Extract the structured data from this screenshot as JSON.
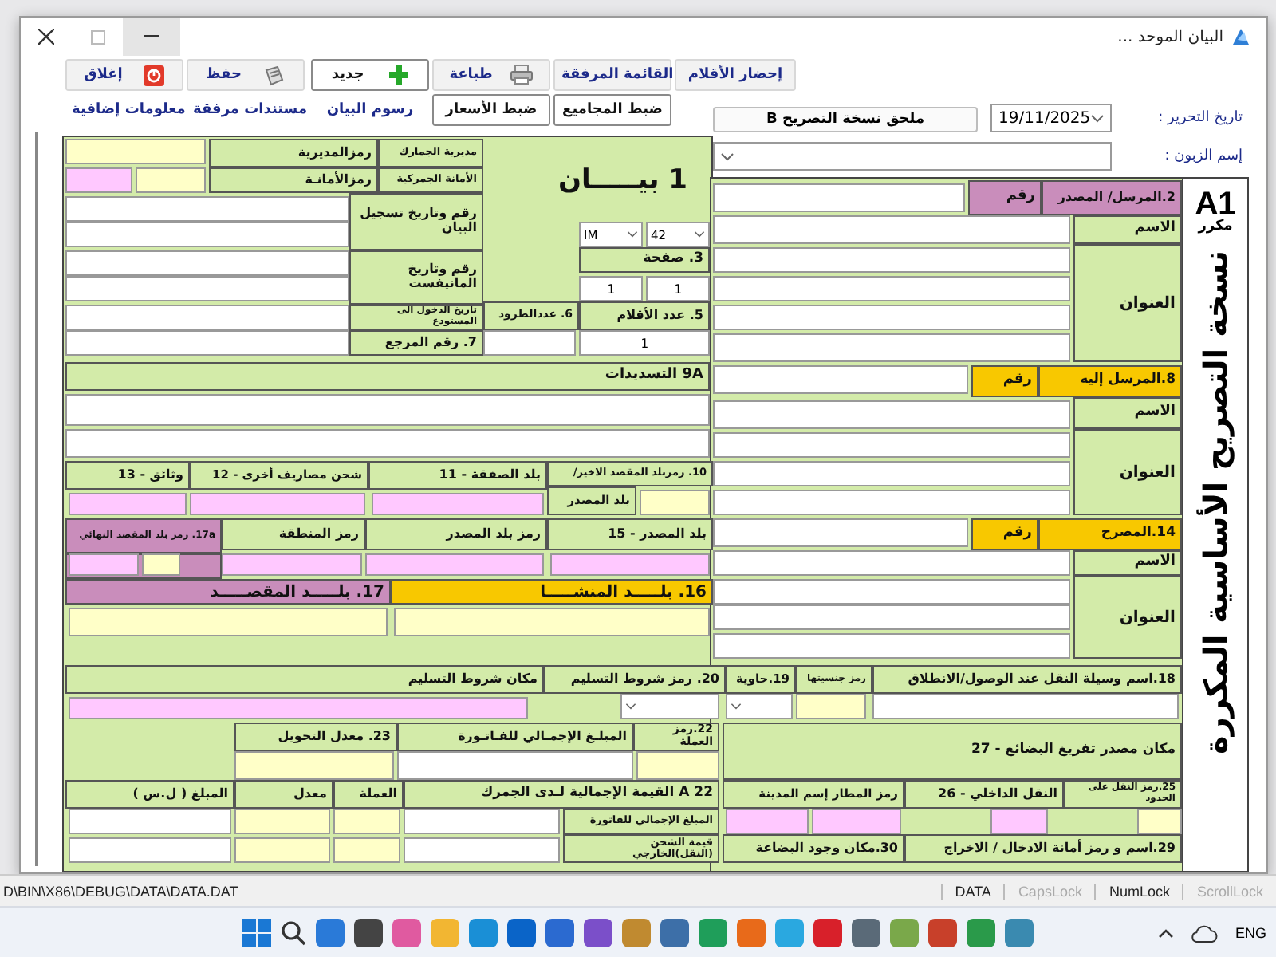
{
  "window": {
    "title": "البيان الموحد ..."
  },
  "toolbar": [
    {
      "label": "إحضار الأقلام",
      "kind": "raised"
    },
    {
      "label": "القائمة المرفقة",
      "kind": "raised"
    },
    {
      "label": "طباعة",
      "kind": "raised"
    },
    {
      "label": "جديد",
      "kind": "default"
    },
    {
      "label": "حفظ",
      "kind": "raised"
    },
    {
      "label": "إغلاق",
      "kind": "raised"
    },
    {
      "label": "ضبط المجاميع",
      "kind": "default"
    },
    {
      "label": "ضبط الأسعار",
      "kind": "default"
    },
    {
      "label": "رسوم البيان",
      "kind": "flat"
    },
    {
      "label": "مستندات مرفقة",
      "kind": "flat"
    },
    {
      "label": "معلومات إضافية",
      "kind": "flat"
    }
  ],
  "header": {
    "date_label": "تاريخ التحرير :",
    "date": "19/11/2025",
    "annex_button": "ملحق نسخة التصريح B",
    "customer_label": "إسم الزبون :"
  },
  "copy_marker": {
    "code": "A1",
    "label": "مكرر"
  },
  "vertical_title": "نسخة التصريح الأساسية المكررة",
  "form": {
    "cells": [
      {
        "kind": "label-mauve",
        "text": "2.المرسل/ المصدر"
      },
      {
        "kind": "label-mauve",
        "text": "رقم"
      },
      {
        "kind": "input"
      },
      {
        "kind": "label",
        "text": "الاسم"
      },
      {
        "kind": "input"
      },
      {
        "kind": "label",
        "text": "العنوان"
      },
      {
        "kind": "input"
      },
      {
        "kind": "input"
      },
      {
        "kind": "input"
      },
      {
        "kind": "input"
      },
      {
        "kind": "title",
        "text": "1 بيـــــان"
      },
      {
        "kind": "label",
        "text": "مديرية الجمارك"
      },
      {
        "kind": "label",
        "text": "رمزالمديرية"
      },
      {
        "kind": "input-yellow"
      },
      {
        "kind": "label",
        "text": "الأمانة الجمركية"
      },
      {
        "kind": "label",
        "text": "رمزالأمانـة"
      },
      {
        "kind": "input-yellow"
      },
      {
        "kind": "input-pink"
      },
      {
        "kind": "select",
        "value": "42"
      },
      {
        "kind": "select",
        "value": "IM"
      },
      {
        "kind": "label",
        "text": "رقم وتاريخ تسجيل البيان"
      },
      {
        "kind": "input"
      },
      {
        "kind": "input"
      },
      {
        "kind": "label",
        "text": "3. صفحة"
      },
      {
        "kind": "input",
        "value": "1"
      },
      {
        "kind": "input",
        "value": "1"
      },
      {
        "kind": "label",
        "text": "رقم وتاريخ المانيفست"
      },
      {
        "kind": "input"
      },
      {
        "kind": "input"
      },
      {
        "kind": "label",
        "text": "5. عدد الأقلام"
      },
      {
        "kind": "label",
        "text": "6. عددالطرود"
      },
      {
        "kind": "label",
        "text": "تاريخ الدخول الى المستودع"
      },
      {
        "kind": "input"
      },
      {
        "kind": "input",
        "value": "1"
      },
      {
        "kind": "input"
      },
      {
        "kind": "label",
        "text": "7. رقم المرجع"
      },
      {
        "kind": "input"
      },
      {
        "kind": "label-gold",
        "text": "8.المرسل إليه"
      },
      {
        "kind": "label-gold",
        "text": "رقم"
      },
      {
        "kind": "input"
      },
      {
        "kind": "label",
        "text": "9A التسديدات"
      },
      {
        "kind": "label",
        "text": "الاسم"
      },
      {
        "kind": "input"
      },
      {
        "kind": "input"
      },
      {
        "kind": "label",
        "text": "العنوان"
      },
      {
        "kind": "input"
      },
      {
        "kind": "input"
      },
      {
        "kind": "input"
      },
      {
        "kind": "input"
      },
      {
        "kind": "label",
        "text": "10. رمزبلد المقصد الاخير/"
      },
      {
        "kind": "label",
        "text": "بلد المصدر"
      },
      {
        "kind": "input-yellow"
      },
      {
        "kind": "label",
        "text": "بلد الصفقة - 11"
      },
      {
        "kind": "input-pink"
      },
      {
        "kind": "label",
        "text": "شحن مصاريف أخرى - 12"
      },
      {
        "kind": "input-pink"
      },
      {
        "kind": "label",
        "text": "وثائق - 13"
      },
      {
        "kind": "input-pink"
      },
      {
        "kind": "label-gold",
        "text": "14.المصرح"
      },
      {
        "kind": "label-gold",
        "text": "رقم"
      },
      {
        "kind": "input"
      },
      {
        "kind": "label",
        "text": "بلد المصدر - 15"
      },
      {
        "kind": "input-pink"
      },
      {
        "kind": "label",
        "text": "رمز بلد المصدر"
      },
      {
        "kind": "input-pink"
      },
      {
        "kind": "label",
        "text": "رمز المنطقة"
      },
      {
        "kind": "input-pink"
      },
      {
        "kind": "label-mauve",
        "text": "17a. رمز بلد المقصد النهائي"
      },
      {
        "kind": "input-pink"
      },
      {
        "kind": "input-yellow"
      },
      {
        "kind": "label",
        "text": "الاسم"
      },
      {
        "kind": "input"
      },
      {
        "kind": "label-gold",
        "text": "16.  بلـــــد المنشـــــا"
      },
      {
        "kind": "label-mauve",
        "text": "17.  بلـــــد المقصـــــد"
      },
      {
        "kind": "label",
        "text": "العنوان"
      },
      {
        "kind": "input"
      },
      {
        "kind": "input-yellow"
      },
      {
        "kind": "input-yellow"
      },
      {
        "kind": "input"
      },
      {
        "kind": "input"
      },
      {
        "kind": "label",
        "text": "18.اسم وسيلة النقل عند الوصول/الانطلاق"
      },
      {
        "kind": "label",
        "text": "رمز جنسيتها"
      },
      {
        "kind": "label",
        "text": "19.حاوية"
      },
      {
        "kind": "label",
        "text": "20. رمز شروط التسليم"
      },
      {
        "kind": "label",
        "text": "مكان شروط التسليم"
      },
      {
        "kind": "input"
      },
      {
        "kind": "input-yellow"
      },
      {
        "kind": "select"
      },
      {
        "kind": "select"
      },
      {
        "kind": "input-pink"
      },
      {
        "kind": "label",
        "text": "مكان مصدر تفريغ البضائع - 27"
      },
      {
        "kind": "label",
        "text": "22.رمز العملة"
      },
      {
        "kind": "input-yellow"
      },
      {
        "kind": "label",
        "text": "المبلـغ الإجمـالي للفـاتـورة"
      },
      {
        "kind": "input"
      },
      {
        "kind": "label",
        "text": "23. معدل التحويل"
      },
      {
        "kind": "input-yellow"
      },
      {
        "kind": "label",
        "text": "25.رمز النقل على الحدود"
      },
      {
        "kind": "label",
        "text": "النقل الداخلي - 26"
      },
      {
        "kind": "label",
        "text": "رمز المطار إسم المدينة"
      },
      {
        "kind": "label",
        "text": "22 A  القيمة الإجمالية لـدى الجمرك"
      },
      {
        "kind": "label",
        "text": "العملة"
      },
      {
        "kind": "label",
        "text": "معدل"
      },
      {
        "kind": "label",
        "text": "المبلغ ( ل.س )"
      },
      {
        "kind": "input-yellow"
      },
      {
        "kind": "input-pink"
      },
      {
        "kind": "input-pink"
      },
      {
        "kind": "input-pink"
      },
      {
        "kind": "label",
        "text": "المبلغ الإجمالي للفاتورة"
      },
      {
        "kind": "input"
      },
      {
        "kind": "input-yellow"
      },
      {
        "kind": "input-yellow"
      },
      {
        "kind": "input"
      },
      {
        "kind": "label",
        "text": "29.اسم و رمز أمانة الادخال / الاخراج"
      },
      {
        "kind": "label",
        "text": "30.مكان وجود البضاعة"
      },
      {
        "kind": "label",
        "text": "قيمة الشحن (النقل)الخارجي"
      },
      {
        "kind": "input"
      },
      {
        "kind": "input-yellow"
      },
      {
        "kind": "input-yellow"
      },
      {
        "kind": "input"
      }
    ]
  },
  "status_bar": {
    "path": "D\\BIN\\X86\\DEBUG\\DATA\\DATA.DAT",
    "indicators": [
      {
        "label": "ScrollLock",
        "on": false
      },
      {
        "label": "NumLock",
        "on": true
      },
      {
        "label": "CapsLock",
        "on": false
      },
      {
        "label": "DATA",
        "on": true
      }
    ]
  },
  "taskbar": {
    "language": "ENG"
  }
}
